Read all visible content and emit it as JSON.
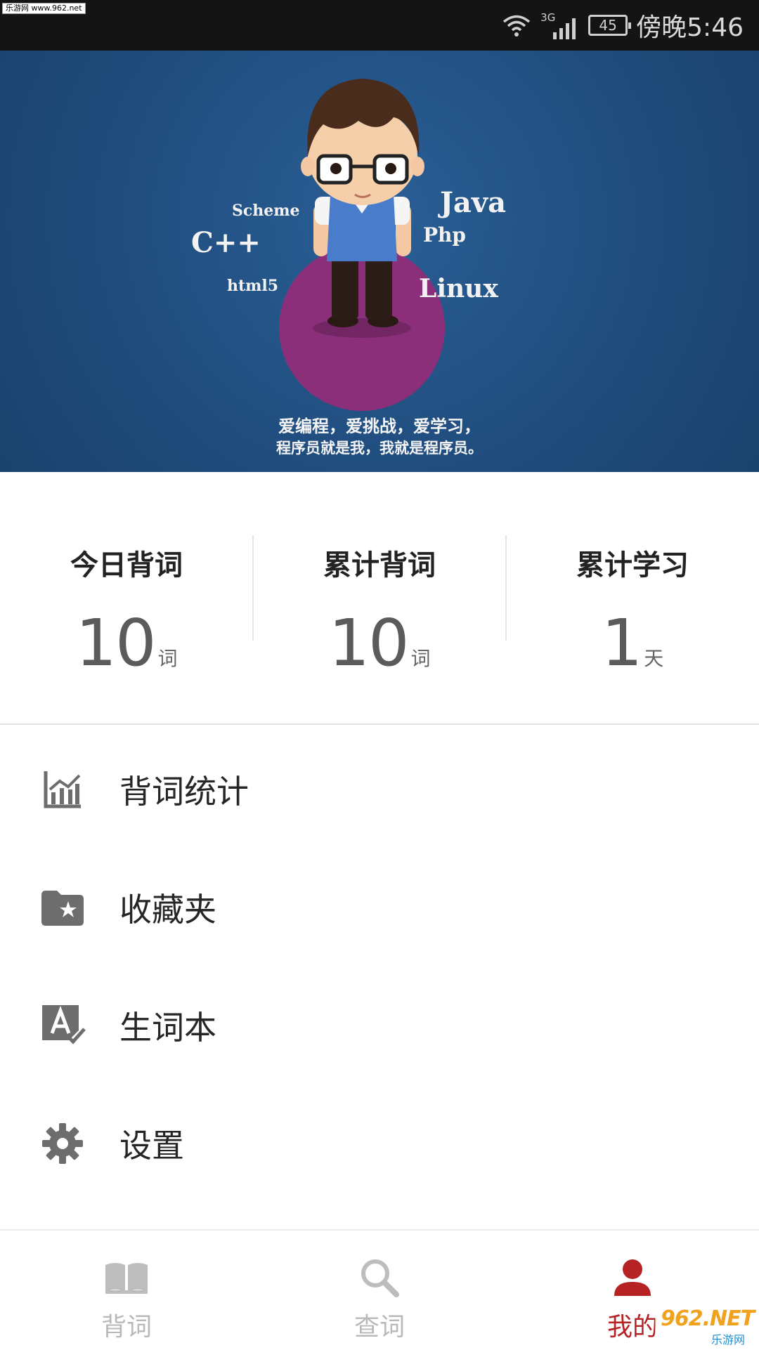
{
  "status_bar": {
    "watermark": "乐游网 www.962.net",
    "network": "3G",
    "battery": "45",
    "time": "傍晚5:46"
  },
  "banner": {
    "words": [
      "Scheme",
      "Java",
      "C++",
      "Php",
      "html5",
      "Linux"
    ],
    "caption_line1": "爱编程，爱挑战，爱学习，",
    "caption_line2": "程序员就是我，我就是程序员。"
  },
  "stats": [
    {
      "title": "今日背词",
      "value": "10",
      "unit": "词"
    },
    {
      "title": "累计背词",
      "value": "10",
      "unit": "词"
    },
    {
      "title": "累计学习",
      "value": "1",
      "unit": "天"
    }
  ],
  "menu": {
    "items": [
      {
        "label": "背词统计",
        "icon": "chart-icon"
      },
      {
        "label": "收藏夹",
        "icon": "folder-star-icon"
      },
      {
        "label": "生词本",
        "icon": "spellcheck-icon"
      },
      {
        "label": "设置",
        "icon": "gear-icon"
      }
    ]
  },
  "bottom_nav": {
    "items": [
      {
        "label": "背词",
        "icon": "book-icon",
        "active": false
      },
      {
        "label": "查词",
        "icon": "search-icon",
        "active": false
      },
      {
        "label": "我的",
        "icon": "person-icon",
        "active": true
      }
    ]
  },
  "watermark_bottom": {
    "text_main": "962.NET",
    "text_sub": "乐游网"
  },
  "colors": {
    "accent": "#b52325",
    "banner_blue": "#204d7e",
    "status_bg": "#141414",
    "icon_gray": "#6d6d6d"
  }
}
